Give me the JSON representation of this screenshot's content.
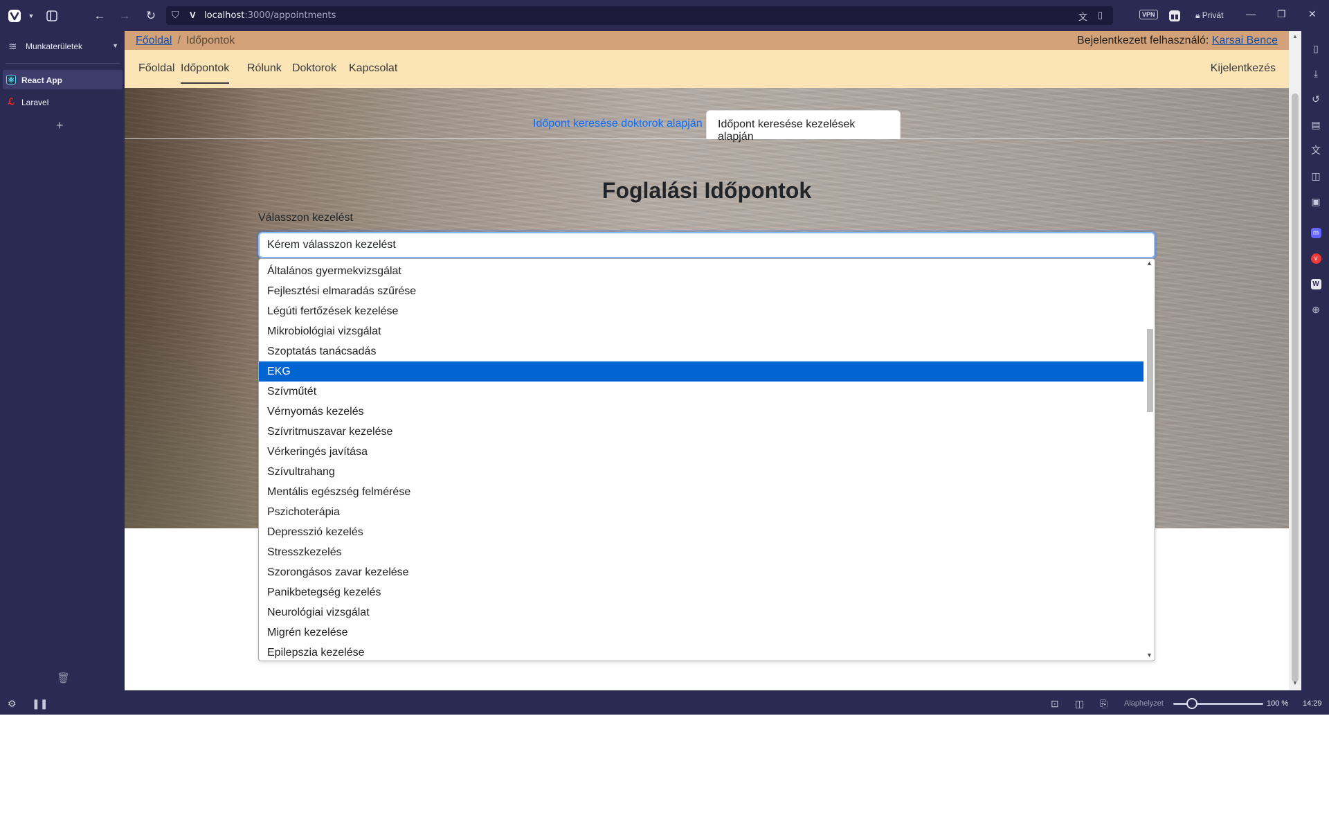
{
  "browser": {
    "url_host": "localhost",
    "url_path": ":3000/appointments",
    "vpn_label": "VPN",
    "private_label": "Privát",
    "icons": [
      "vivaldi-logo-icon",
      "panel-toggle-icon",
      "back-icon",
      "forward-icon",
      "reload-icon",
      "shield-icon",
      "translate-icon",
      "bookmark-icon",
      "gift-icon",
      "lock-icon",
      "minimize-icon",
      "restore-icon",
      "close-icon"
    ]
  },
  "left_panel": {
    "workspaces_label": "Munkaterületek",
    "tabs": [
      {
        "label": "React App",
        "icon": "react-icon"
      },
      {
        "label": "Laravel",
        "icon": "laravel-icon"
      }
    ]
  },
  "status_bar": {
    "zoom_reset_label": "Alaphelyzet",
    "zoom_value": "100 %",
    "zoom_level": 100,
    "time": "14:29"
  },
  "page": {
    "breadcrumb": {
      "home": "Főoldal",
      "current": "Időpontok"
    },
    "user_prefix": "Bejelentkezett felhasználó:",
    "user_name": "Karsai Bence",
    "nav": [
      "Főoldal",
      "Időpontok",
      "Rólunk",
      "Doktorok",
      "Kapcsolat"
    ],
    "logout": "Kijelentkezés",
    "tabs": [
      "Időpont keresése doktorok alapján",
      "Időpont keresése kezelések alapján"
    ],
    "active_tab": 1,
    "title": "Foglalási Időpontok",
    "select_label": "Válasszon kezelést",
    "select_value": "Kérem válasszon kezelést",
    "options": [
      "Általános gyermekvizsgálat",
      "Fejlesztési elmaradás szűrése",
      "Légúti fertőzések kezelése",
      "Mikrobiológiai vizsgálat",
      "Szoptatás tanácsadás",
      "EKG",
      "Szívműtét",
      "Vérnyomás kezelés",
      "Szívritmuszavar kezelése",
      "Vérkeringés javítása",
      "Szívultrahang",
      "Mentális egészség felmérése",
      "Pszichoterápia",
      "Depresszió kezelés",
      "Stresszkezelés",
      "Szorongásos zavar kezelése",
      "Panikbetegség kezelés",
      "Neurológiai vizsgálat",
      "Migrén kezelése",
      "Epilepszia kezelése"
    ],
    "selected_option": "EKG"
  }
}
